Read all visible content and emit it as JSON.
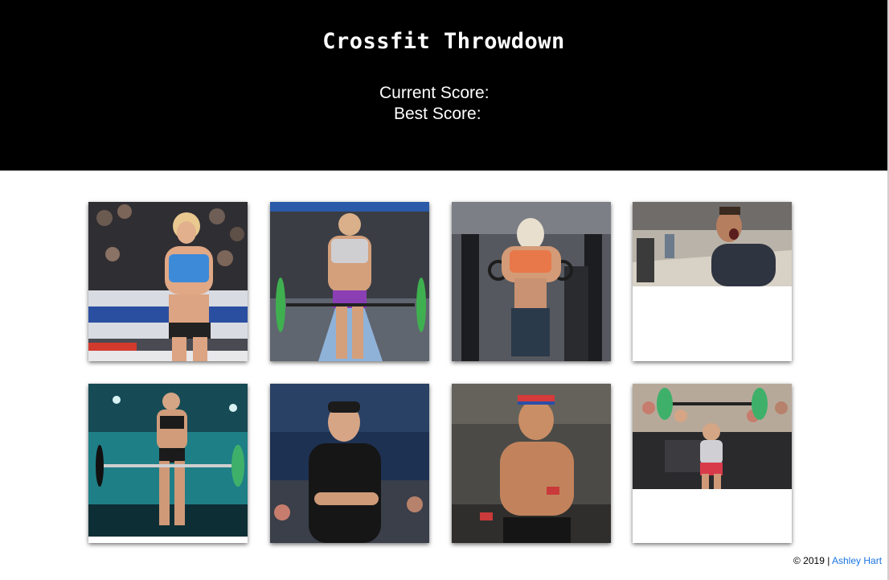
{
  "header": {
    "title": "Crossfit Throwdown",
    "current_score_label": "Current Score:",
    "best_score_label": "Best Score:"
  },
  "cards": [
    {
      "name": "athlete-blonde-blue-top",
      "image_fill": 1.0
    },
    {
      "name": "athlete-deadlift-grey-top",
      "image_fill": 1.0
    },
    {
      "name": "athlete-rings-orange-top",
      "image_fill": 1.0
    },
    {
      "name": "athlete-man-yelling",
      "image_fill": 0.53
    },
    {
      "name": "athlete-deadlift-teal-gym",
      "image_fill": 0.96
    },
    {
      "name": "athlete-man-crossfit-shirt",
      "image_fill": 1.0
    },
    {
      "name": "athlete-man-headband",
      "image_fill": 1.0
    },
    {
      "name": "athlete-overhead-games",
      "image_fill": 0.66
    }
  ],
  "footer": {
    "copyright": "© 2019 |",
    "author_link": "Ashley Hart"
  },
  "colors": {
    "header_bg": "#000000",
    "link": "#1a74e0"
  }
}
